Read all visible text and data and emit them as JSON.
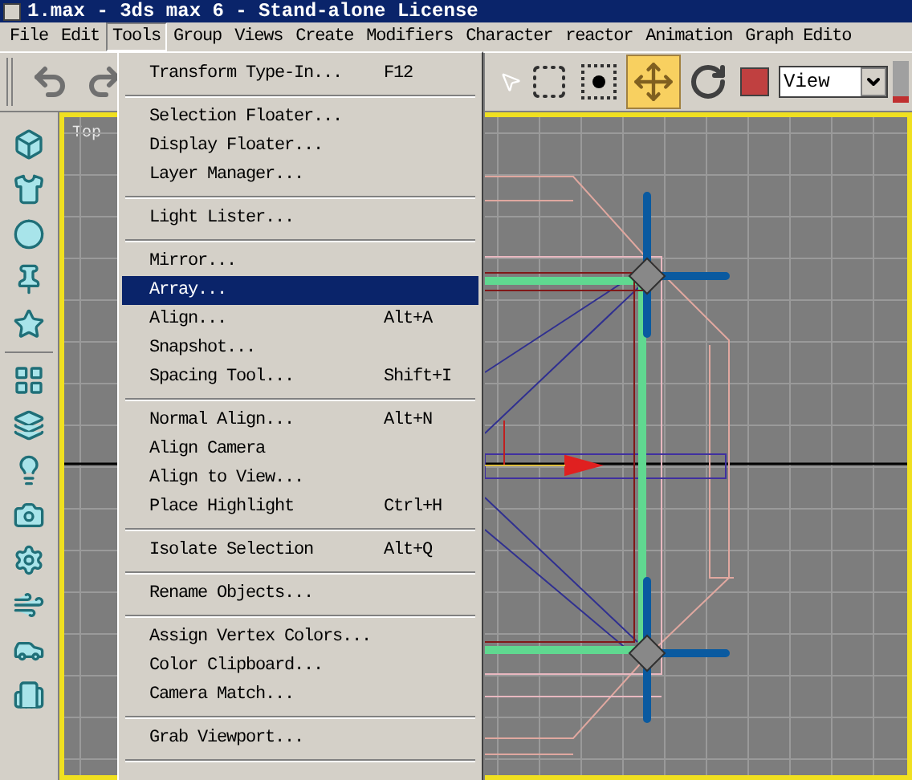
{
  "window": {
    "title": "1.max - 3ds max 6 - Stand-alone License"
  },
  "menu_bar": [
    {
      "label": "File",
      "selected": false
    },
    {
      "label": "Edit",
      "selected": false
    },
    {
      "label": "Tools",
      "selected": true
    },
    {
      "label": "Group",
      "selected": false
    },
    {
      "label": "Views",
      "selected": false
    },
    {
      "label": "Create",
      "selected": false
    },
    {
      "label": "Modifiers",
      "selected": false
    },
    {
      "label": "Character",
      "selected": false
    },
    {
      "label": "reactor",
      "selected": false
    },
    {
      "label": "Animation",
      "selected": false
    },
    {
      "label": "Graph Edito",
      "selected": false
    }
  ],
  "toolbar": {
    "move_selected": true,
    "view_dropdown": "View"
  },
  "viewport": {
    "label": "Top"
  },
  "tools_menu": [
    {
      "kind": "item",
      "label": "Transform Type-In...",
      "shortcut": "F12",
      "selected": false
    },
    {
      "kind": "separator"
    },
    {
      "kind": "item",
      "label": "Selection Floater...",
      "selected": false
    },
    {
      "kind": "item",
      "label": "Display Floater...",
      "selected": false
    },
    {
      "kind": "item",
      "label": "Layer Manager...",
      "selected": false
    },
    {
      "kind": "separator"
    },
    {
      "kind": "item",
      "label": "Light Lister...",
      "selected": false
    },
    {
      "kind": "separator"
    },
    {
      "kind": "item",
      "label": "Mirror...",
      "selected": false
    },
    {
      "kind": "item",
      "label": "Array...",
      "selected": true
    },
    {
      "kind": "item",
      "label": "Align...",
      "shortcut": "Alt+A",
      "selected": false
    },
    {
      "kind": "item",
      "label": "Snapshot...",
      "selected": false
    },
    {
      "kind": "item",
      "label": "Spacing Tool...",
      "shortcut": "Shift+I",
      "selected": false
    },
    {
      "kind": "separator"
    },
    {
      "kind": "item",
      "label": "Normal Align...",
      "shortcut": "Alt+N",
      "selected": false
    },
    {
      "kind": "item",
      "label": "Align Camera",
      "selected": false
    },
    {
      "kind": "item",
      "label": "Align to View...",
      "selected": false
    },
    {
      "kind": "item",
      "label": "Place Highlight",
      "shortcut": "Ctrl+H",
      "selected": false
    },
    {
      "kind": "separator"
    },
    {
      "kind": "item",
      "label": "Isolate Selection",
      "shortcut": "Alt+Q",
      "selected": false
    },
    {
      "kind": "separator"
    },
    {
      "kind": "item",
      "label": "Rename Objects...",
      "selected": false
    },
    {
      "kind": "separator"
    },
    {
      "kind": "item",
      "label": "Assign Vertex Colors...",
      "selected": false
    },
    {
      "kind": "item",
      "label": "Color Clipboard...",
      "selected": false
    },
    {
      "kind": "item",
      "label": "Camera Match...",
      "selected": false
    },
    {
      "kind": "separator"
    },
    {
      "kind": "item",
      "label": "Grab Viewport...",
      "selected": false
    },
    {
      "kind": "separator"
    }
  ]
}
